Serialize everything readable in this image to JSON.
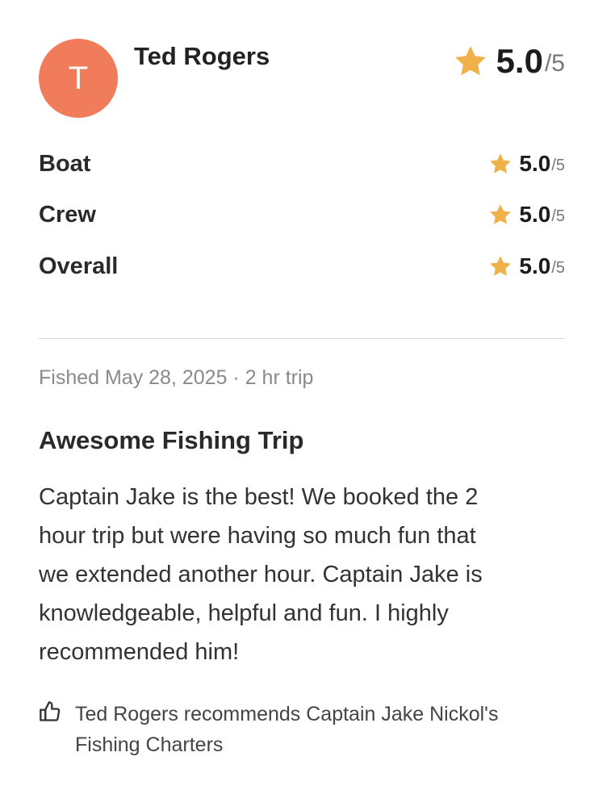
{
  "reviewer": {
    "initial": "T",
    "name": "Ted Rogers",
    "avatar_color": "#f07c5b"
  },
  "overall": {
    "score": "5.0",
    "out_of": "/5",
    "icon": "star-icon",
    "star_color": "#f0b04a"
  },
  "categories": [
    {
      "label": "Boat",
      "score": "5.0",
      "out_of": "/5"
    },
    {
      "label": "Crew",
      "score": "5.0",
      "out_of": "/5"
    },
    {
      "label": "Overall",
      "score": "5.0",
      "out_of": "/5"
    }
  ],
  "trip_meta": "Fished May 28, 2025 · 2 hr trip",
  "review": {
    "title": "Awesome Fishing Trip",
    "body_lines": [
      "Captain Jake is the best!  We booked the 2",
      "hour trip but were having so much fun that",
      "we extended another hour.  Captain Jake is",
      "knowledgeable, helpful and fun.  I highly",
      "recommended him!"
    ]
  },
  "recommendation": {
    "icon": "thumbs-up-icon",
    "lines": [
      "Ted Rogers recommends Captain Jake Nickol's",
      "Fishing Charters"
    ]
  }
}
